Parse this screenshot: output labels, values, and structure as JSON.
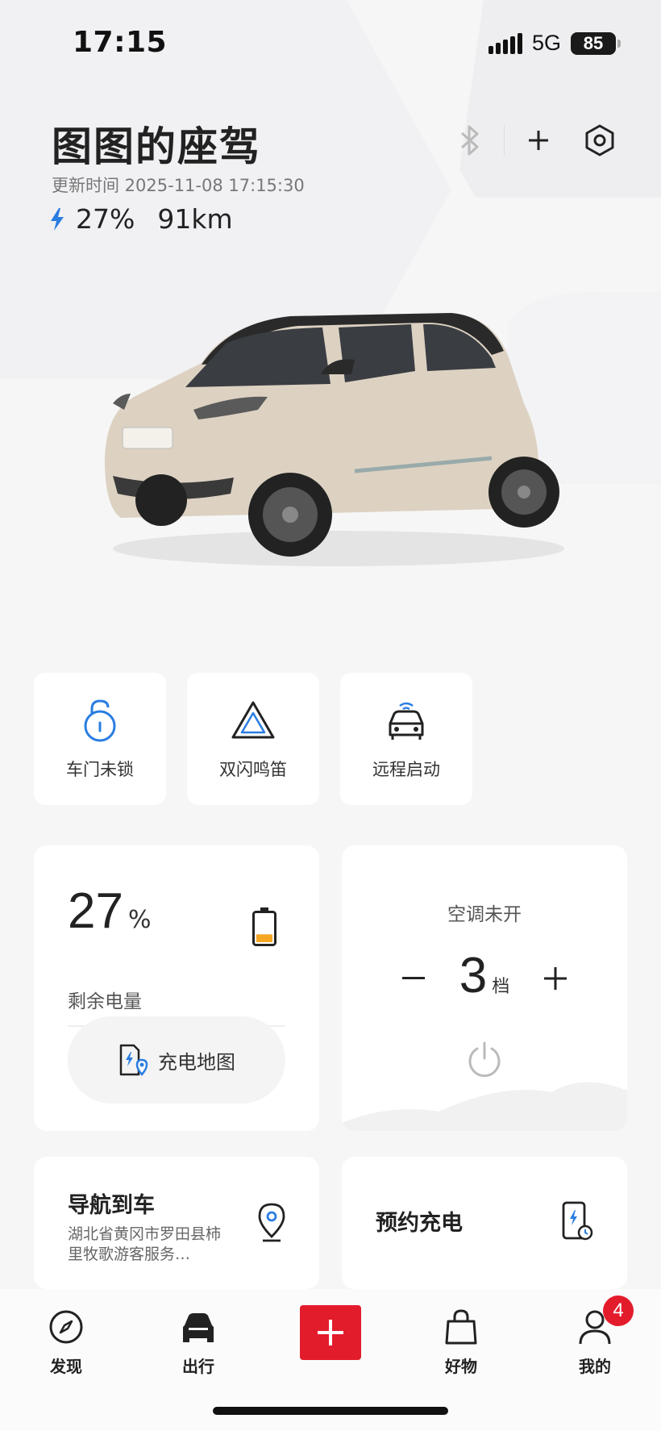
{
  "status_bar": {
    "time": "17:15",
    "network": "5G",
    "battery": "85"
  },
  "header": {
    "title": "图图的座驾",
    "updated": "更新时间 2025-11-08 17:15:30",
    "battery_pct": "27%",
    "range": "91km"
  },
  "quick_actions": [
    {
      "label": "车门未锁",
      "icon": "unlock-icon"
    },
    {
      "label": "双闪鸣笛",
      "icon": "hazard-icon"
    },
    {
      "label": "远程启动",
      "icon": "remote-start-icon"
    }
  ],
  "battery_card": {
    "value": "27",
    "unit": "%",
    "label": "剩余电量",
    "charge_map": "充电地图",
    "fill_fraction": 0.27
  },
  "ac_card": {
    "title": "空调未开",
    "level": "3",
    "level_unit": "档"
  },
  "nav_card": {
    "title": "导航到车",
    "address": "湖北省黄冈市罗田县柿里牧歌游客服务…"
  },
  "schedule_card": {
    "title": "预约充电"
  },
  "tabbar": {
    "tabs": [
      {
        "label": "发现",
        "icon": "compass-icon"
      },
      {
        "label": "出行",
        "icon": "car-icon"
      },
      {
        "label": "好物",
        "icon": "shopping-bag-icon"
      },
      {
        "label": "我的",
        "icon": "user-icon"
      }
    ],
    "badge": "4"
  },
  "colors": {
    "accent_red": "#e31c2c",
    "accent_blue": "#2a7de1",
    "battery_orange": "#f5a623"
  }
}
